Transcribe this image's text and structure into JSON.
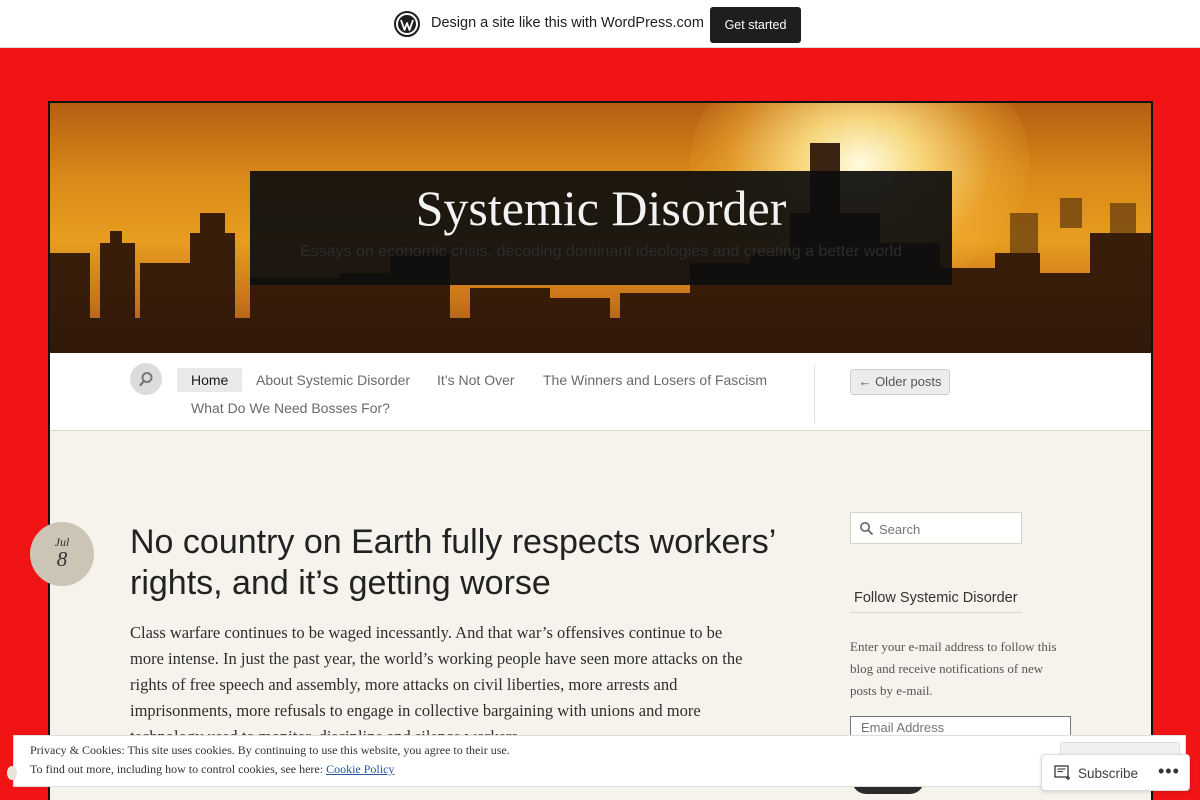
{
  "wpbar": {
    "text": "Design a site like this with WordPress.com",
    "button": "Get started"
  },
  "header": {
    "title": "Systemic Disorder",
    "tagline": "Essays on economic crisis, decoding dominant ideologies and creating a better world"
  },
  "nav": {
    "items": [
      {
        "label": "Home"
      },
      {
        "label": "About Systemic Disorder"
      },
      {
        "label": "It’s Not Over"
      },
      {
        "label": "The Winners and Losers of Fascism"
      },
      {
        "label": "What Do We Need Bosses For?"
      }
    ],
    "older_posts": "← Older posts"
  },
  "post": {
    "date_month": "Jul",
    "date_day": "8",
    "title": "No country on Earth fully respects workers’ rights, and it’s getting worse",
    "body": "Class warfare continues to be waged incessantly. And that war’s offensives continue to be more intense. In just the past year, the world’s working people have seen more attacks on the rights of free speech and assembly, more attacks on civil liberties, more arrests and imprisonments, more refusals to engage in collective bargaining with unions and more technology used to monitor, discipline and silence workers."
  },
  "sidebar": {
    "search_placeholder": "Search",
    "follow_title": "Follow Systemic Disorder",
    "follow_text": "Enter your e-mail address to follow this blog and receive notifications of new posts by e-mail.",
    "email_placeholder": "Email Address"
  },
  "cookie": {
    "line1": "Privacy & Cookies: This site uses cookies. By continuing to use this website, you agree to their use.",
    "line2": "To find out more, including how to control cookies, see here:",
    "link": "Cookie Policy"
  },
  "subscribe": {
    "label": "Subscribe",
    "more": "•••"
  }
}
